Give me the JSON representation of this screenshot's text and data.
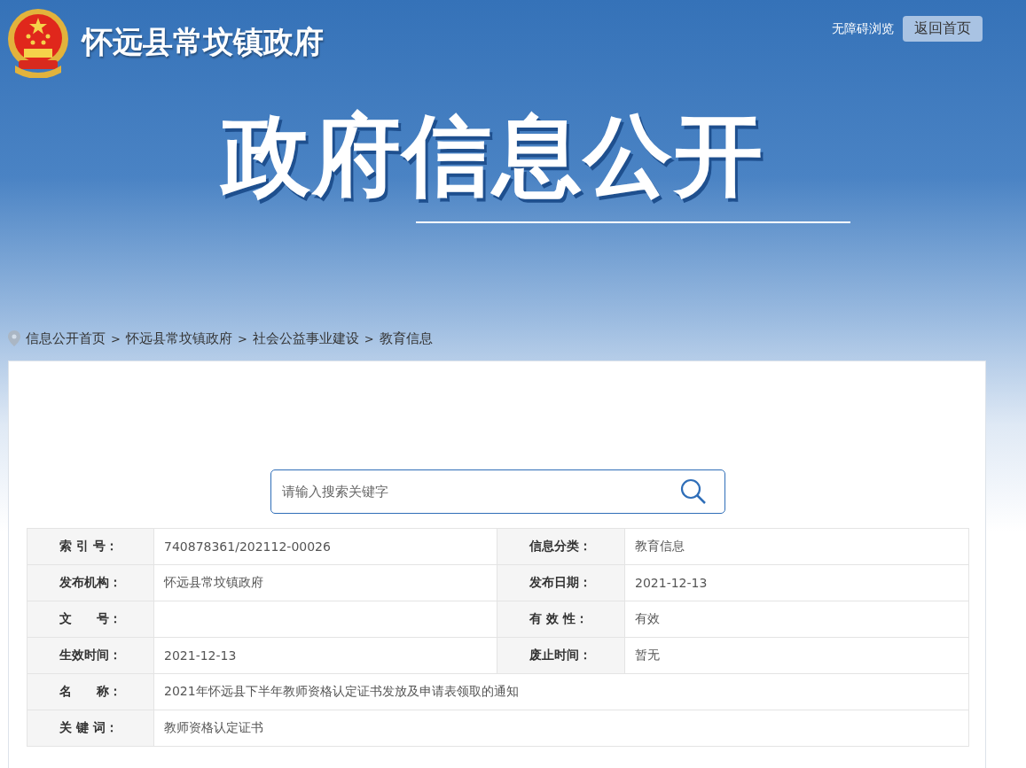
{
  "site": {
    "title": "怀远县常坟镇政府"
  },
  "header_links": {
    "accessibility": "无障碍浏览",
    "home_button": "返回首页"
  },
  "banner": {
    "title": "政府信息公开"
  },
  "breadcrumb": [
    "信息公开首页",
    "怀远县常坟镇政府",
    "社会公益事业建设",
    "教育信息"
  ],
  "breadcrumb_separator": ">",
  "search": {
    "placeholder": "请输入搜索关键字"
  },
  "info_table": {
    "rows": [
      {
        "cells": [
          {
            "label": "索 引 号：",
            "value": "740878361/202112-00026"
          },
          {
            "label": "信息分类：",
            "value": "教育信息"
          }
        ]
      },
      {
        "cells": [
          {
            "label": "发布机构：",
            "value": "怀远县常坟镇政府"
          },
          {
            "label": "发布日期：",
            "value": "2021-12-13"
          }
        ]
      },
      {
        "cells": [
          {
            "label": "文　　号："
          },
          {
            "label": "有 效 性：",
            "value": "有效"
          }
        ]
      },
      {
        "cells": [
          {
            "label": "生效时间：",
            "value": "2021-12-13"
          },
          {
            "label": "废止时间：",
            "value": "暂无"
          }
        ]
      },
      {
        "cells": [
          {
            "label": "名　　称：",
            "value": "2021年怀远县下半年教师资格认定证书发放及申请表领取的通知"
          }
        ]
      },
      {
        "cells": [
          {
            "label": "关 键 词：",
            "value": "教师资格认定证书"
          }
        ]
      }
    ]
  }
}
